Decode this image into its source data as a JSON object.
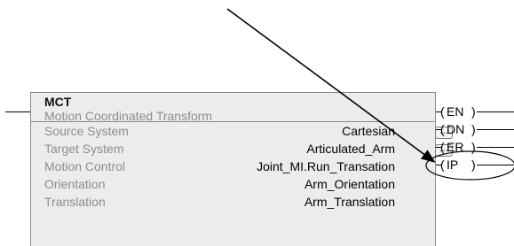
{
  "block": {
    "mnemonic": "MCT",
    "description": "Motion Coordinated Transform",
    "operands": [
      {
        "label": "Source System",
        "value": "Cartesian",
        "has_browse": true
      },
      {
        "label": "Target System",
        "value": "Articulated_Arm",
        "has_browse": true
      },
      {
        "label": "Motion Control",
        "value": "Joint_MI.Run_Transation",
        "has_browse": false
      },
      {
        "label": "Orientation",
        "value": "Arm_Orientation",
        "has_browse": false
      },
      {
        "label": "Translation",
        "value": "Arm_Translation",
        "has_browse": false
      }
    ],
    "browse_label": "..."
  },
  "outputs": [
    "EN",
    "DN",
    "ER",
    "IP"
  ],
  "annotation": {
    "highlighted_output": "IP",
    "arrow_color": "#000000"
  }
}
